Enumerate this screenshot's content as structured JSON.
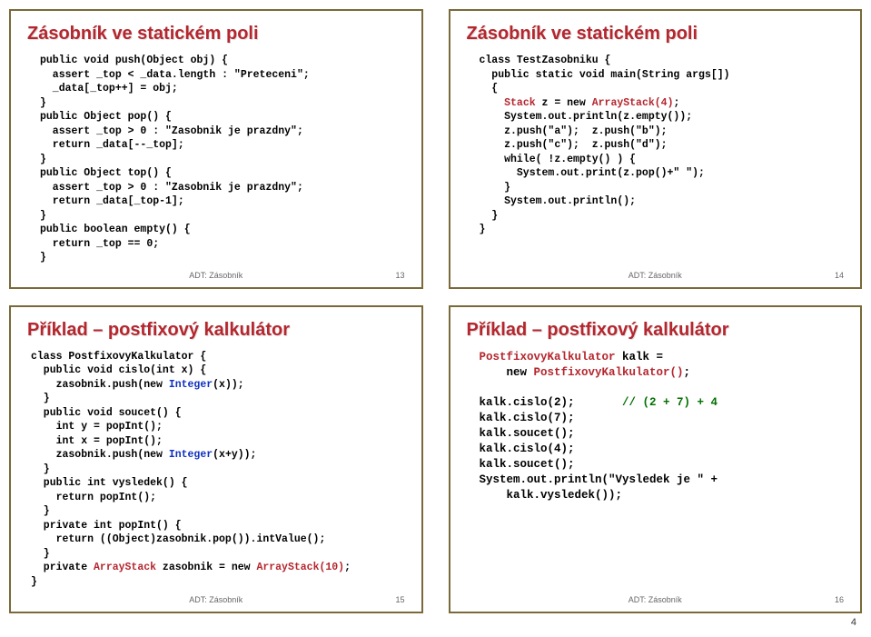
{
  "slide13": {
    "title": "Zásobník ve statickém poli",
    "footer": "ADT: Zásobník",
    "page": "13"
  },
  "slide14": {
    "title": "Zásobník ve statickém poli",
    "footer": "ADT: Zásobník",
    "page": "14"
  },
  "slide15": {
    "title": "Příklad – postfixový kalkulátor",
    "footer": "ADT: Zásobník",
    "page": "15"
  },
  "slide16": {
    "title": "Příklad – postfixový kalkulátor",
    "footer": "ADT: Zásobník",
    "page": "16"
  },
  "pageNumber": "4",
  "code13_l1": "public void push(Object obj) {",
  "code13_l2": "  assert _top < _data.length : \"Preteceni\";",
  "code13_l3": "  _data[_top++] = obj;",
  "code13_l4": "}",
  "code13_l5": "public Object pop() {",
  "code13_l6": "  assert _top > 0 : \"Zasobnik je prazdny\";",
  "code13_l7": "  return _data[--_top];",
  "code13_l8": "}",
  "code13_l9": "public Object top() {",
  "code13_l10": "  assert _top > 0 : \"Zasobnik je prazdny\";",
  "code13_l11": "  return _data[_top-1];",
  "code13_l12": "}",
  "code13_l13": "public boolean empty() {",
  "code13_l14": "  return _top == 0;",
  "code13_l15": "}",
  "code14_l1": "class TestZasobniku {",
  "code14_l2": "  public static void main(String args[])",
  "code14_l3": "  {",
  "code14_l4a": "    ",
  "code14_l4b": "Stack",
  "code14_l4c": " z = new ",
  "code14_l4d": "ArrayStack(4)",
  "code14_l4e": ";",
  "code14_l5": "    System.out.println(z.empty());",
  "code14_l6": "    z.push(\"a\");  z.push(\"b\");",
  "code14_l7": "    z.push(\"c\");  z.push(\"d\");",
  "code14_l8": "    while( !z.empty() ) {",
  "code14_l9": "      System.out.print(z.pop()+\" \");",
  "code14_l10": "    }",
  "code14_l11": "    System.out.println();",
  "code14_l12": "  }",
  "code14_l13": "}",
  "code15_l1": "class PostfixovyKalkulator {",
  "code15_l2": "  public void cislo(int x) {",
  "code15_l3a": "    zasobnik.push(new ",
  "code15_l3b": "Integer",
  "code15_l3c": "(x));",
  "code15_l4": "  }",
  "code15_l5": "  public void soucet() {",
  "code15_l6": "    int y = popInt();",
  "code15_l7": "    int x = popInt();",
  "code15_l8a": "    zasobnik.push(new ",
  "code15_l8b": "Integer",
  "code15_l8c": "(x+y));",
  "code15_l9": "  }",
  "code15_l10": "  public int vysledek() {",
  "code15_l11": "    return popInt();",
  "code15_l12": "  }",
  "code15_l13": "  private int popInt() {",
  "code15_l14": "    return ((Object)zasobnik.pop()).intValue();",
  "code15_l15": "  }",
  "code15_l16a": "  private ",
  "code15_l16b": "ArrayStack",
  "code15_l16c": " zasobnik = new ",
  "code15_l16d": "ArrayStack(10)",
  "code15_l16e": ";",
  "code15_l17": "}",
  "code16_l1a": "PostfixovyKalkulator",
  "code16_l1b": " kalk =",
  "code16_l2a": "    new ",
  "code16_l2b": "PostfixovyKalkulator()",
  "code16_l2c": ";",
  "code16_blank": "",
  "code16_l3a": "kalk.cislo(2);",
  "code16_l3b": "       // (2 + 7) + 4",
  "code16_l4": "kalk.cislo(7);",
  "code16_l5": "kalk.soucet();",
  "code16_l6": "kalk.cislo(4);",
  "code16_l7": "kalk.soucet();",
  "code16_l8": "System.out.println(\"Vysledek je \" +",
  "code16_l9": "    kalk.vysledek());"
}
